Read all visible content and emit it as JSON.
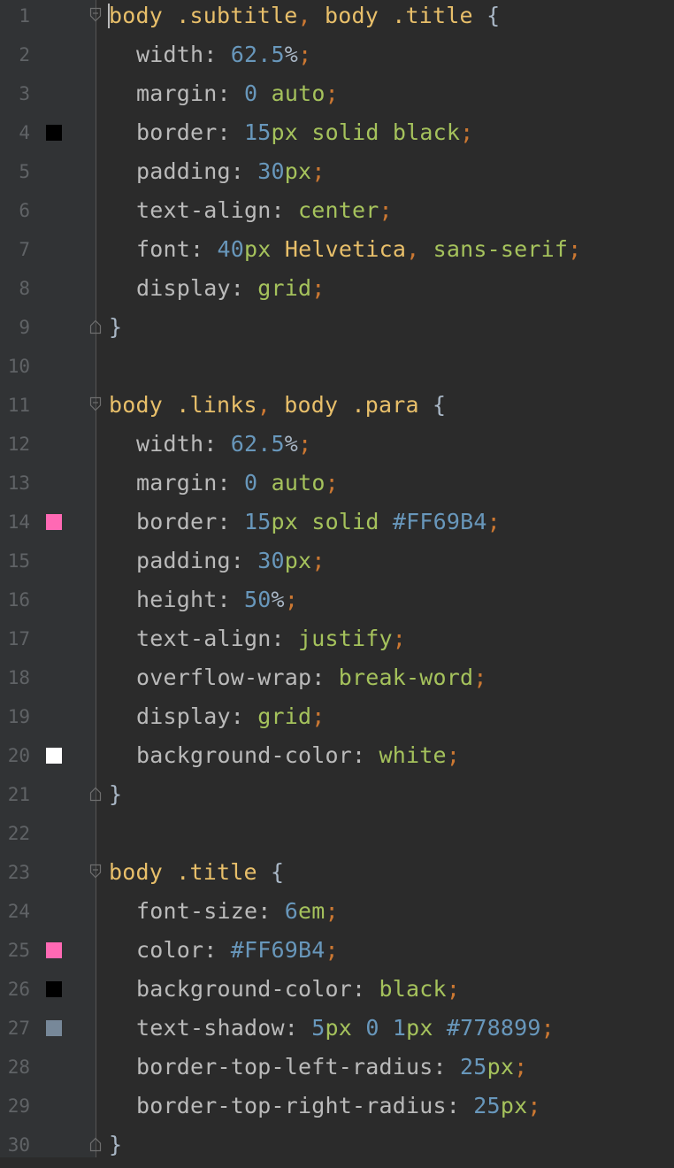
{
  "colors": {
    "background": "#2b2b2b",
    "gutter": "#313335",
    "line_number": "#606366",
    "selector": "#e8bf6a",
    "punctuation": "#cc7832",
    "property": "#bababa",
    "number": "#6897bb",
    "keyword": "#a5c25c"
  },
  "lines": [
    {
      "n": "1"
    },
    {
      "n": "2"
    },
    {
      "n": "3"
    },
    {
      "n": "4",
      "swatch": "#000000"
    },
    {
      "n": "5"
    },
    {
      "n": "6"
    },
    {
      "n": "7"
    },
    {
      "n": "8"
    },
    {
      "n": "9"
    },
    {
      "n": "10"
    },
    {
      "n": "11"
    },
    {
      "n": "12"
    },
    {
      "n": "13"
    },
    {
      "n": "14",
      "swatch": "#FF69B4"
    },
    {
      "n": "15"
    },
    {
      "n": "16"
    },
    {
      "n": "17"
    },
    {
      "n": "18"
    },
    {
      "n": "19"
    },
    {
      "n": "20",
      "swatch": "#FFFFFF"
    },
    {
      "n": "21"
    },
    {
      "n": "22"
    },
    {
      "n": "23"
    },
    {
      "n": "24"
    },
    {
      "n": "25",
      "swatch": "#FF69B4"
    },
    {
      "n": "26",
      "swatch": "#000000"
    },
    {
      "n": "27",
      "swatch": "#778899"
    },
    {
      "n": "28"
    },
    {
      "n": "29"
    },
    {
      "n": "30"
    }
  ],
  "code": {
    "l1": {
      "sel1": "body .subtitle",
      "comma": ",",
      "sel2": " body .title ",
      "brace": "{"
    },
    "l2": {
      "prop": "width",
      "colon": ": ",
      "num": "62.5",
      "pct": "%",
      "semi": ";"
    },
    "l3": {
      "prop": "margin",
      "colon": ": ",
      "num": "0",
      "sp": " ",
      "kw": "auto",
      "semi": ";"
    },
    "l4": {
      "prop": "border",
      "colon": ": ",
      "num": "15",
      "unit": "px",
      "kw": " solid black",
      "semi": ";"
    },
    "l5": {
      "prop": "padding",
      "colon": ": ",
      "num": "30",
      "unit": "px",
      "semi": ";"
    },
    "l6": {
      "prop": "text-align",
      "colon": ": ",
      "kw": "center",
      "semi": ";"
    },
    "l7": {
      "prop": "font",
      "colon": ": ",
      "num": "40",
      "unit": "px",
      "font": " Helvetica",
      "comma": ",",
      "kw": " sans-serif",
      "semi": ";"
    },
    "l8": {
      "prop": "display",
      "colon": ": ",
      "kw": "grid",
      "semi": ";"
    },
    "l9": {
      "brace": "}"
    },
    "l11": {
      "sel1": "body .links",
      "comma": ",",
      "sel2": " body .para ",
      "brace": "{"
    },
    "l12": {
      "prop": "width",
      "colon": ": ",
      "num": "62.5",
      "pct": "%",
      "semi": ";"
    },
    "l13": {
      "prop": "margin",
      "colon": ": ",
      "num": "0",
      "sp": " ",
      "kw": "auto",
      "semi": ";"
    },
    "l14": {
      "prop": "border",
      "colon": ": ",
      "num": "15",
      "unit": "px",
      "kw": " solid ",
      "hex": "#FF69B4",
      "semi": ";"
    },
    "l15": {
      "prop": "padding",
      "colon": ": ",
      "num": "30",
      "unit": "px",
      "semi": ";"
    },
    "l16": {
      "prop": "height",
      "colon": ": ",
      "num": "50",
      "pct": "%",
      "semi": ";"
    },
    "l17": {
      "prop": "text-align",
      "colon": ": ",
      "kw": "justify",
      "semi": ";"
    },
    "l18": {
      "prop": "overflow-wrap",
      "colon": ": ",
      "kw": "break-word",
      "semi": ";"
    },
    "l19": {
      "prop": "display",
      "colon": ": ",
      "kw": "grid",
      "semi": ";"
    },
    "l20": {
      "prop": "background-color",
      "colon": ": ",
      "kw": "white",
      "semi": ";"
    },
    "l21": {
      "brace": "}"
    },
    "l23": {
      "sel1": "body .title ",
      "brace": "{"
    },
    "l24": {
      "prop": "font-size",
      "colon": ": ",
      "num": "6",
      "unit": "em",
      "semi": ";"
    },
    "l25": {
      "prop": "color",
      "colon": ": ",
      "hex": "#FF69B4",
      "semi": ";"
    },
    "l26": {
      "prop": "background-color",
      "colon": ": ",
      "kw": "black",
      "semi": ";"
    },
    "l27": {
      "prop": "text-shadow",
      "colon": ": ",
      "num1": "5",
      "unit1": "px",
      "num2": " 0",
      "num3": " 1",
      "unit3": "px",
      "hex": " #778899",
      "semi": ";"
    },
    "l28": {
      "prop": "border-top-left-radius",
      "colon": ": ",
      "num": "25",
      "unit": "px",
      "semi": ";"
    },
    "l29": {
      "prop": "border-top-right-radius",
      "colon": ": ",
      "num": "25",
      "unit": "px",
      "semi": ";"
    },
    "l30": {
      "brace": "}"
    }
  }
}
